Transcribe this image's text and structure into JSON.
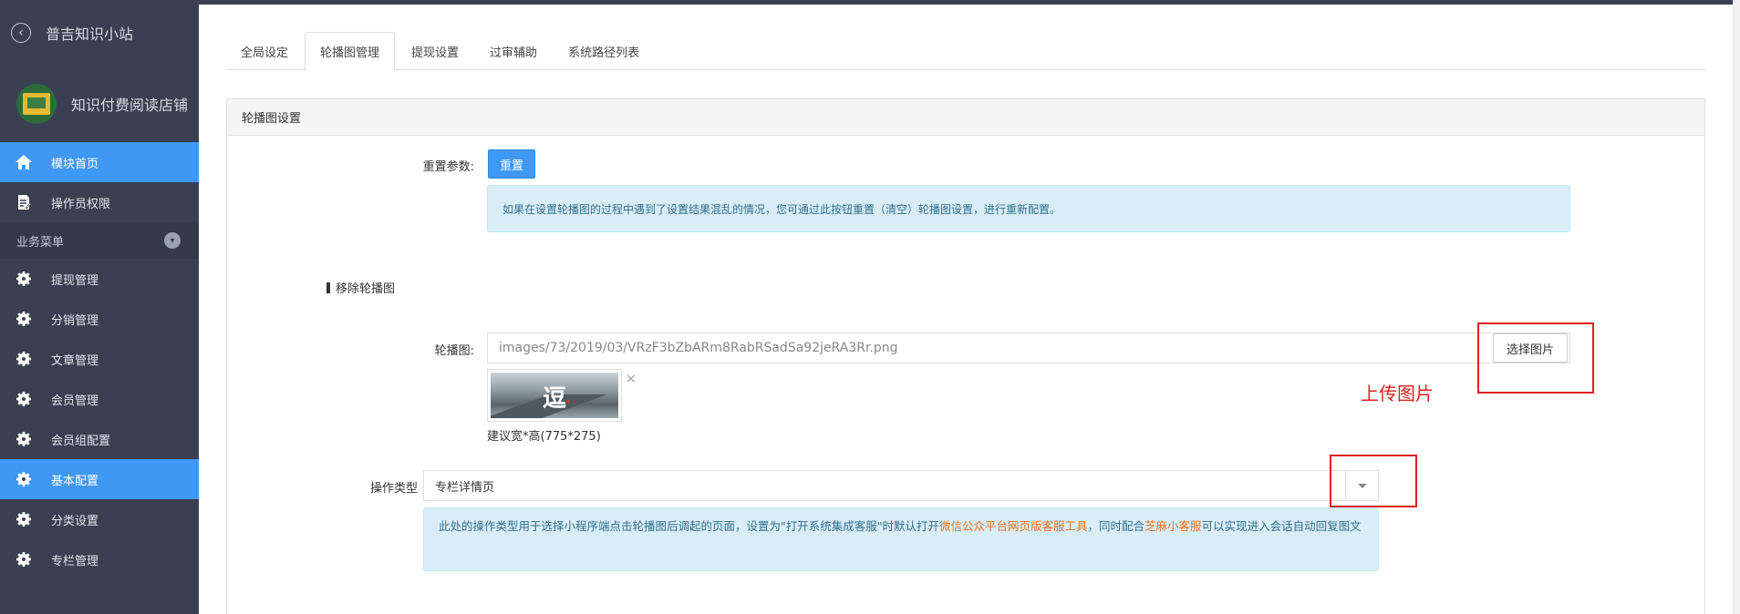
{
  "sidebar": {
    "title": "普吉知识小站",
    "store_name": "知识付费阅读店铺",
    "items": [
      {
        "label": "模块首页",
        "icon": "home-icon",
        "active": true
      },
      {
        "label": "操作员权限",
        "icon": "document-edit-icon",
        "active": false
      }
    ],
    "group_label": "业务菜单",
    "group_items": [
      {
        "label": "提现管理",
        "icon": "gear-icon",
        "active": false
      },
      {
        "label": "分销管理",
        "icon": "gear-icon",
        "active": false
      },
      {
        "label": "文章管理",
        "icon": "gear-icon",
        "active": false
      },
      {
        "label": "会员管理",
        "icon": "gear-icon",
        "active": false
      },
      {
        "label": "会员组配置",
        "icon": "gear-icon",
        "active": false
      },
      {
        "label": "基本配置",
        "icon": "gear-icon",
        "active": true
      },
      {
        "label": "分类设置",
        "icon": "gear-icon",
        "active": false
      },
      {
        "label": "专栏管理",
        "icon": "gear-icon",
        "active": false
      }
    ]
  },
  "tabs": [
    {
      "label": "全局设定",
      "active": false
    },
    {
      "label": "轮播图管理",
      "active": true
    },
    {
      "label": "提现设置",
      "active": false
    },
    {
      "label": "过审辅助",
      "active": false
    },
    {
      "label": "系统路径列表",
      "active": false
    }
  ],
  "panel": {
    "heading": "轮播图设置",
    "reset_label": "重置参数:",
    "reset_button": "重置",
    "reset_info": "如果在设置轮播图的过程中遇到了设置结果混乱的情况，您可通过此按钮重置（清空）轮播图设置，进行重新配置。",
    "remove_section": "移除轮播图",
    "image_label": "轮播图:",
    "image_path": "images/73/2019/03/VRzF3bZbARm8RabRSadSa92jeRA3Rr.png",
    "choose_image_button": "选择图片",
    "thumb_glyph": "逗",
    "close_mark": "×",
    "size_hint": "建议宽*高(775*275)",
    "op_type_label": "操作类型",
    "op_type_value": "专栏详情页",
    "op_info_part1": "此处的操作类型用于选择小程序端点击轮播图后调起的页面，设置为\"打开系统集成客服\"时默认打开",
    "op_info_hl1": "微信公众平台网页版客服工具",
    "op_info_part2": "，同时配合",
    "op_info_hl2": "芝麻小客服",
    "op_info_part3": "可以实现进入会话自动回复图文"
  },
  "annotation": {
    "upload_text": "上传图片",
    "color": "#e02020"
  },
  "colors": {
    "sidebar_bg": "#3a3f51",
    "active_blue": "#3f98f5",
    "info_bg": "#d9edf7",
    "highlight_orange": "#e8731a"
  }
}
